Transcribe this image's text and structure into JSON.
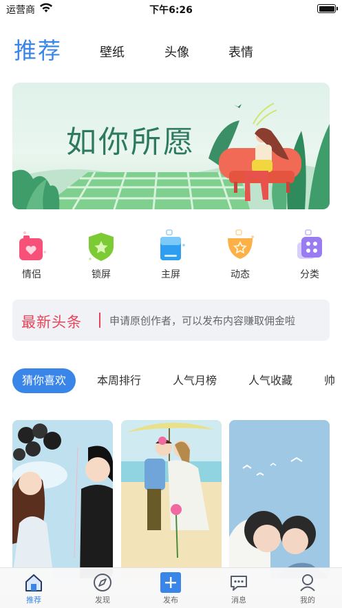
{
  "status_bar": {
    "carrier": "运营商",
    "time": "下午6:26",
    "battery_level": 1.0
  },
  "top_tabs": [
    {
      "label": "推荐",
      "active": true
    },
    {
      "label": "壁纸",
      "active": false
    },
    {
      "label": "头像",
      "active": false
    },
    {
      "label": "表情",
      "active": false
    }
  ],
  "banner": {
    "title": "如你所愿"
  },
  "categories": [
    {
      "label": "情侣",
      "icon": "couple-icon"
    },
    {
      "label": "锁屏",
      "icon": "lockscreen-icon"
    },
    {
      "label": "主屏",
      "icon": "homescreen-icon"
    },
    {
      "label": "动态",
      "icon": "dynamic-icon"
    },
    {
      "label": "分类",
      "icon": "category-icon"
    }
  ],
  "headline": {
    "title": "最新头条",
    "text": "申请原创作者，可以发布内容赚取佣金啦"
  },
  "filter_chips": [
    {
      "label": "猜你喜欢",
      "active": true
    },
    {
      "label": "本周排行",
      "active": false
    },
    {
      "label": "人气月榜",
      "active": false
    },
    {
      "label": "人气收藏",
      "active": false
    },
    {
      "label": "帅",
      "active": false
    }
  ],
  "bottom_nav": [
    {
      "label": "推荐",
      "icon": "home-icon",
      "active": true
    },
    {
      "label": "发现",
      "icon": "compass-icon",
      "active": false
    },
    {
      "label": "发布",
      "icon": "plus-icon",
      "active": false
    },
    {
      "label": "消息",
      "icon": "message-icon",
      "active": false
    },
    {
      "label": "我的",
      "icon": "profile-icon",
      "active": false
    }
  ],
  "colors": {
    "accent": "#3a86e8",
    "headline_red": "#e8455a",
    "banner_green": "#2e7a5f"
  }
}
